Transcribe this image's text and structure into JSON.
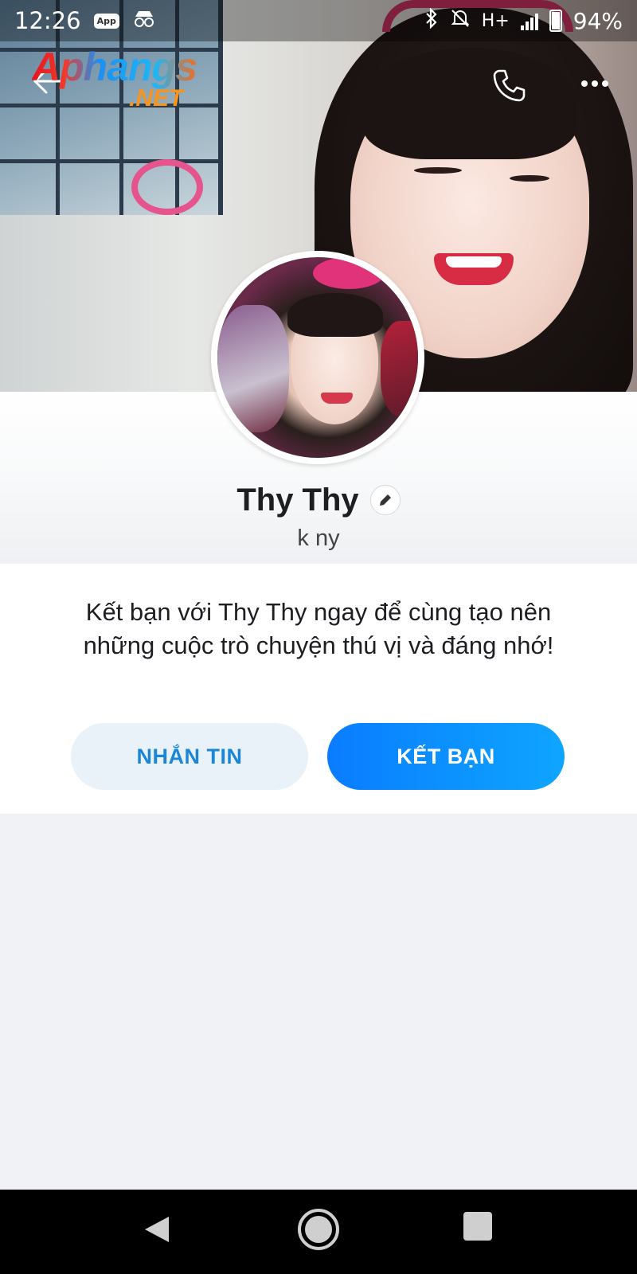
{
  "status_bar": {
    "time": "12:26",
    "app_badge": "App",
    "network": "H+",
    "battery": "94%"
  },
  "watermark": {
    "main": "Aphangs",
    "suffix": ".NET"
  },
  "profile": {
    "name": "Thy Thy",
    "subtitle": "k ny"
  },
  "prompt": {
    "text": "Kết bạn với Thy Thy ngay để cùng tạo nên những cuộc trò chuyện thú vị và đáng nhớ!",
    "message_button": "NHẮN TIN",
    "add_friend_button": "KẾT BẠN"
  },
  "colors": {
    "accent_blue": "#0a7cff",
    "message_button_bg": "#eaf2f9",
    "message_button_text": "#1b86d6",
    "page_bg": "#f0f2f5"
  },
  "icons": {
    "back": "arrow-left-icon",
    "call": "phone-icon",
    "more": "more-horizontal-icon",
    "edit": "pencil-icon",
    "bluetooth": "bluetooth-icon",
    "mute": "bell-off-icon",
    "signal": "signal-icon",
    "battery": "battery-icon",
    "incognito": "incognito-icon",
    "nav_back": "triangle-back-icon",
    "nav_home": "circle-home-icon",
    "nav_recents": "square-recents-icon"
  }
}
